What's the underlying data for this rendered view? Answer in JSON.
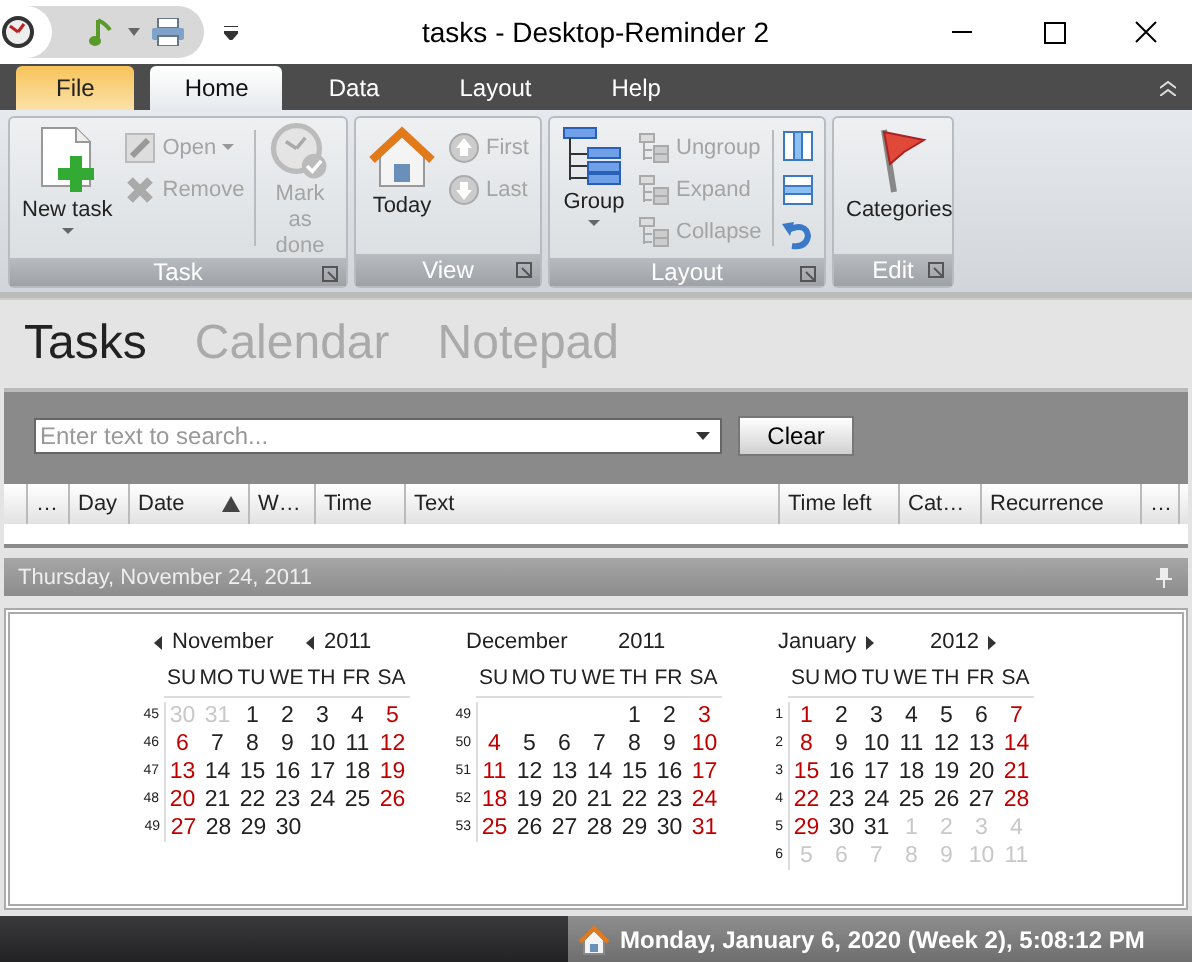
{
  "window": {
    "title": "tasks - Desktop-Reminder 2"
  },
  "ribbon_tabs": [
    {
      "label": "File",
      "kind": "file",
      "selected": false
    },
    {
      "label": "Home",
      "kind": "tab",
      "selected": true
    },
    {
      "label": "Data",
      "kind": "tab",
      "selected": false
    },
    {
      "label": "Layout",
      "kind": "tab",
      "selected": false
    },
    {
      "label": "Help",
      "kind": "tab",
      "selected": false
    }
  ],
  "ribbon_groups": [
    {
      "label": "Task",
      "items": [
        {
          "label": "New task",
          "disabled": false,
          "dropdown": true
        },
        {
          "label": "Open",
          "disabled": true,
          "dropdown": true
        },
        {
          "label": "Remove",
          "disabled": true,
          "dropdown": false
        },
        {
          "label": "Mark as done",
          "disabled": true,
          "dropdown": false
        }
      ]
    },
    {
      "label": "View",
      "items": [
        {
          "label": "Today",
          "disabled": false,
          "dropdown": false
        },
        {
          "label": "First",
          "disabled": true,
          "dropdown": false
        },
        {
          "label": "Last",
          "disabled": true,
          "dropdown": false
        }
      ]
    },
    {
      "label": "Layout",
      "items": [
        {
          "label": "Group",
          "disabled": false,
          "dropdown": true
        },
        {
          "label": "Ungroup",
          "disabled": true,
          "dropdown": false
        },
        {
          "label": "Expand",
          "disabled": true,
          "dropdown": false
        },
        {
          "label": "Collapse",
          "disabled": true,
          "dropdown": false
        }
      ]
    },
    {
      "label": "Edit",
      "items": [
        {
          "label": "Categories",
          "disabled": false,
          "dropdown": false
        }
      ]
    }
  ],
  "views": [
    {
      "label": "Tasks",
      "selected": true
    },
    {
      "label": "Calendar",
      "selected": false
    },
    {
      "label": "Notepad",
      "selected": false
    }
  ],
  "search": {
    "placeholder": "Enter text to search..."
  },
  "clear_button": "Clear",
  "columns": [
    {
      "label": "…",
      "sorted": false
    },
    {
      "label": "Day",
      "sorted": false
    },
    {
      "label": "Date",
      "sorted": true
    },
    {
      "label": "W…",
      "sorted": false
    },
    {
      "label": "Time",
      "sorted": false
    },
    {
      "label": "Text",
      "sorted": false
    },
    {
      "label": "Time left",
      "sorted": false
    },
    {
      "label": "Cat…",
      "sorted": false
    },
    {
      "label": "Recurrence",
      "sorted": false
    },
    {
      "label": "…",
      "sorted": false
    }
  ],
  "date_bar": {
    "title": "Thursday, November 24, 2011"
  },
  "months": [
    {
      "name": "November",
      "year": "2011",
      "prev": true,
      "next": false,
      "weekdays": [
        "SU",
        "MO",
        "TU",
        "WE",
        "TH",
        "FR",
        "SA"
      ],
      "weeks": [
        {
          "week": "45",
          "days": [
            {
              "n": "30",
              "kind": "other"
            },
            {
              "n": "31",
              "kind": "other"
            },
            {
              "n": "1",
              "kind": "plain"
            },
            {
              "n": "2",
              "kind": "plain"
            },
            {
              "n": "3",
              "kind": "plain"
            },
            {
              "n": "4",
              "kind": "plain"
            },
            {
              "n": "5",
              "kind": "weekend"
            }
          ]
        },
        {
          "week": "46",
          "days": [
            {
              "n": "6",
              "kind": "weekend"
            },
            {
              "n": "7",
              "kind": "plain"
            },
            {
              "n": "8",
              "kind": "plain"
            },
            {
              "n": "9",
              "kind": "plain"
            },
            {
              "n": "10",
              "kind": "plain"
            },
            {
              "n": "11",
              "kind": "plain"
            },
            {
              "n": "12",
              "kind": "weekend"
            }
          ]
        },
        {
          "week": "47",
          "days": [
            {
              "n": "13",
              "kind": "weekend"
            },
            {
              "n": "14",
              "kind": "plain"
            },
            {
              "n": "15",
              "kind": "plain"
            },
            {
              "n": "16",
              "kind": "plain"
            },
            {
              "n": "17",
              "kind": "plain"
            },
            {
              "n": "18",
              "kind": "plain"
            },
            {
              "n": "19",
              "kind": "weekend"
            }
          ]
        },
        {
          "week": "48",
          "days": [
            {
              "n": "20",
              "kind": "weekend"
            },
            {
              "n": "21",
              "kind": "plain"
            },
            {
              "n": "22",
              "kind": "plain"
            },
            {
              "n": "23",
              "kind": "plain"
            },
            {
              "n": "24",
              "kind": "plain"
            },
            {
              "n": "25",
              "kind": "plain"
            },
            {
              "n": "26",
              "kind": "weekend"
            }
          ]
        },
        {
          "week": "49",
          "days": [
            {
              "n": "27",
              "kind": "weekend"
            },
            {
              "n": "28",
              "kind": "plain"
            },
            {
              "n": "29",
              "kind": "plain"
            },
            {
              "n": "30",
              "kind": "plain"
            }
          ]
        }
      ]
    },
    {
      "name": "December",
      "year": "2011",
      "prev": false,
      "next": false,
      "weekdays": [
        "SU",
        "MO",
        "TU",
        "WE",
        "TH",
        "FR",
        "SA"
      ],
      "weeks": [
        {
          "week": "49",
          "days": [
            {
              "kind": "blank"
            },
            {
              "kind": "blank"
            },
            {
              "kind": "blank"
            },
            {
              "kind": "blank"
            },
            {
              "n": "1",
              "kind": "plain"
            },
            {
              "n": "2",
              "kind": "plain"
            },
            {
              "n": "3",
              "kind": "weekend"
            }
          ]
        },
        {
          "week": "50",
          "days": [
            {
              "n": "4",
              "kind": "weekend"
            },
            {
              "n": "5",
              "kind": "plain"
            },
            {
              "n": "6",
              "kind": "plain"
            },
            {
              "n": "7",
              "kind": "plain"
            },
            {
              "n": "8",
              "kind": "plain"
            },
            {
              "n": "9",
              "kind": "plain"
            },
            {
              "n": "10",
              "kind": "weekend"
            }
          ]
        },
        {
          "week": "51",
          "days": [
            {
              "n": "11",
              "kind": "weekend"
            },
            {
              "n": "12",
              "kind": "plain"
            },
            {
              "n": "13",
              "kind": "plain"
            },
            {
              "n": "14",
              "kind": "plain"
            },
            {
              "n": "15",
              "kind": "plain"
            },
            {
              "n": "16",
              "kind": "plain"
            },
            {
              "n": "17",
              "kind": "weekend"
            }
          ]
        },
        {
          "week": "52",
          "days": [
            {
              "n": "18",
              "kind": "weekend"
            },
            {
              "n": "19",
              "kind": "plain"
            },
            {
              "n": "20",
              "kind": "plain"
            },
            {
              "n": "21",
              "kind": "plain"
            },
            {
              "n": "22",
              "kind": "plain"
            },
            {
              "n": "23",
              "kind": "plain"
            },
            {
              "n": "24",
              "kind": "weekend"
            }
          ]
        },
        {
          "week": "53",
          "days": [
            {
              "n": "25",
              "kind": "weekend"
            },
            {
              "n": "26",
              "kind": "plain"
            },
            {
              "n": "27",
              "kind": "plain"
            },
            {
              "n": "28",
              "kind": "plain"
            },
            {
              "n": "29",
              "kind": "plain"
            },
            {
              "n": "30",
              "kind": "plain"
            },
            {
              "n": "31",
              "kind": "weekend"
            }
          ]
        }
      ]
    },
    {
      "name": "January",
      "year": "2012",
      "prev": false,
      "next": true,
      "weekdays": [
        "SU",
        "MO",
        "TU",
        "WE",
        "TH",
        "FR",
        "SA"
      ],
      "weeks": [
        {
          "week": "1",
          "days": [
            {
              "n": "1",
              "kind": "weekend"
            },
            {
              "n": "2",
              "kind": "plain"
            },
            {
              "n": "3",
              "kind": "plain"
            },
            {
              "n": "4",
              "kind": "plain"
            },
            {
              "n": "5",
              "kind": "plain"
            },
            {
              "n": "6",
              "kind": "plain"
            },
            {
              "n": "7",
              "kind": "weekend"
            }
          ]
        },
        {
          "week": "2",
          "days": [
            {
              "n": "8",
              "kind": "weekend"
            },
            {
              "n": "9",
              "kind": "plain"
            },
            {
              "n": "10",
              "kind": "plain"
            },
            {
              "n": "11",
              "kind": "plain"
            },
            {
              "n": "12",
              "kind": "plain"
            },
            {
              "n": "13",
              "kind": "plain"
            },
            {
              "n": "14",
              "kind": "weekend"
            }
          ]
        },
        {
          "week": "3",
          "days": [
            {
              "n": "15",
              "kind": "weekend"
            },
            {
              "n": "16",
              "kind": "plain"
            },
            {
              "n": "17",
              "kind": "plain"
            },
            {
              "n": "18",
              "kind": "plain"
            },
            {
              "n": "19",
              "kind": "plain"
            },
            {
              "n": "20",
              "kind": "plain"
            },
            {
              "n": "21",
              "kind": "weekend"
            }
          ]
        },
        {
          "week": "4",
          "days": [
            {
              "n": "22",
              "kind": "weekend"
            },
            {
              "n": "23",
              "kind": "plain"
            },
            {
              "n": "24",
              "kind": "plain"
            },
            {
              "n": "25",
              "kind": "plain"
            },
            {
              "n": "26",
              "kind": "plain"
            },
            {
              "n": "27",
              "kind": "plain"
            },
            {
              "n": "28",
              "kind": "weekend"
            }
          ]
        },
        {
          "week": "5",
          "days": [
            {
              "n": "29",
              "kind": "weekend"
            },
            {
              "n": "30",
              "kind": "plain"
            },
            {
              "n": "31",
              "kind": "plain"
            },
            {
              "n": "1",
              "kind": "other"
            },
            {
              "n": "2",
              "kind": "other"
            },
            {
              "n": "3",
              "kind": "other"
            },
            {
              "n": "4",
              "kind": "other"
            }
          ]
        },
        {
          "week": "6",
          "days": [
            {
              "n": "5",
              "kind": "other"
            },
            {
              "n": "6",
              "kind": "other"
            },
            {
              "n": "7",
              "kind": "other"
            },
            {
              "n": "8",
              "kind": "other"
            },
            {
              "n": "9",
              "kind": "other"
            },
            {
              "n": "10",
              "kind": "other"
            },
            {
              "n": "11",
              "kind": "other"
            }
          ]
        }
      ]
    }
  ],
  "status_bar": {
    "text": "Monday, January 6, 2020 (Week 2), 5:08:12 PM"
  }
}
